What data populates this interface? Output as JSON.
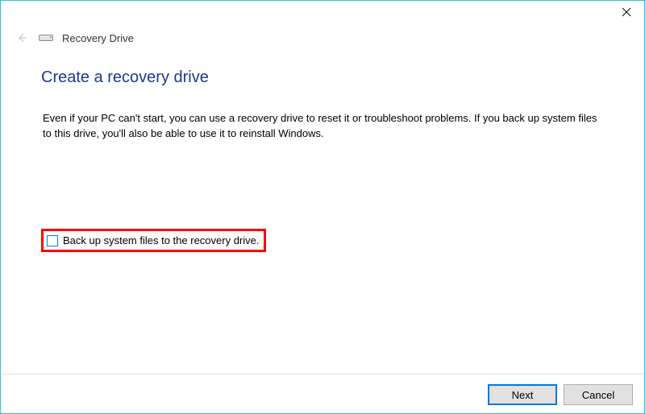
{
  "window": {
    "title": "Recovery Drive"
  },
  "page": {
    "heading": "Create a recovery drive",
    "body": "Even if your PC can't start, you can use a recovery drive to reset it or troubleshoot problems. If you back up system files to this drive, you'll also be able to use it to reinstall Windows."
  },
  "checkbox": {
    "label": "Back up system files to the recovery drive.",
    "checked": false
  },
  "footer": {
    "next": "Next",
    "cancel": "Cancel"
  }
}
